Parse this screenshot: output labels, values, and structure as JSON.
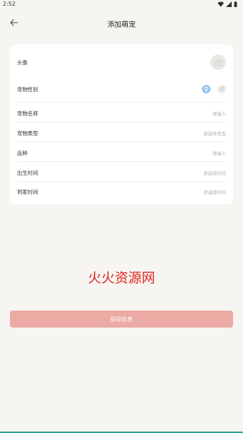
{
  "status_bar": {
    "time": "2:52"
  },
  "header": {
    "title": "添加萌宠"
  },
  "form": {
    "avatar_label": "头像",
    "gender_label": "宠物性别",
    "name_label": "宠物名称",
    "name_placeholder": "请输入",
    "type_label": "宠物类型",
    "type_placeholder": "请选择类型",
    "breed_label": "品种",
    "breed_placeholder": "请输入",
    "birth_label": "出生时间",
    "birth_placeholder": "请选择时间",
    "arrival_label": "到家时间",
    "arrival_placeholder": "请选择时间"
  },
  "watermark": "火火资源网",
  "save_button_label": "保存信息",
  "colors": {
    "background": "#f6f5f2",
    "card": "#ffffff",
    "accent_button": "#ebaba4",
    "male_selected": "#8ec5f2",
    "watermark": "#e0261e"
  },
  "icons": {
    "back": "arrow-left-icon",
    "avatar": "camera-icon",
    "male": "male-icon",
    "female": "female-icon"
  }
}
